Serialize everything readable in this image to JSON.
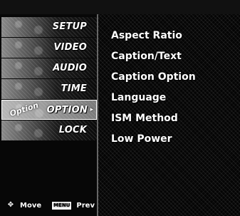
{
  "left_menu": {
    "items": [
      {
        "label": "SETUP"
      },
      {
        "label": "VIDEO"
      },
      {
        "label": "AUDIO"
      },
      {
        "label": "TIME"
      },
      {
        "label": "OPTION",
        "selected": true
      },
      {
        "label": "LOCK"
      }
    ],
    "selected_thumb_text": "Option"
  },
  "option_menu": {
    "items": [
      "Aspect Ratio",
      "Caption/Text",
      "Caption Option",
      "Language",
      "ISM Method",
      "Low Power"
    ]
  },
  "footer": {
    "move_label": "Move",
    "menu_label": "MENU",
    "prev_label": "Prev",
    "move_icon": "move-icon"
  }
}
